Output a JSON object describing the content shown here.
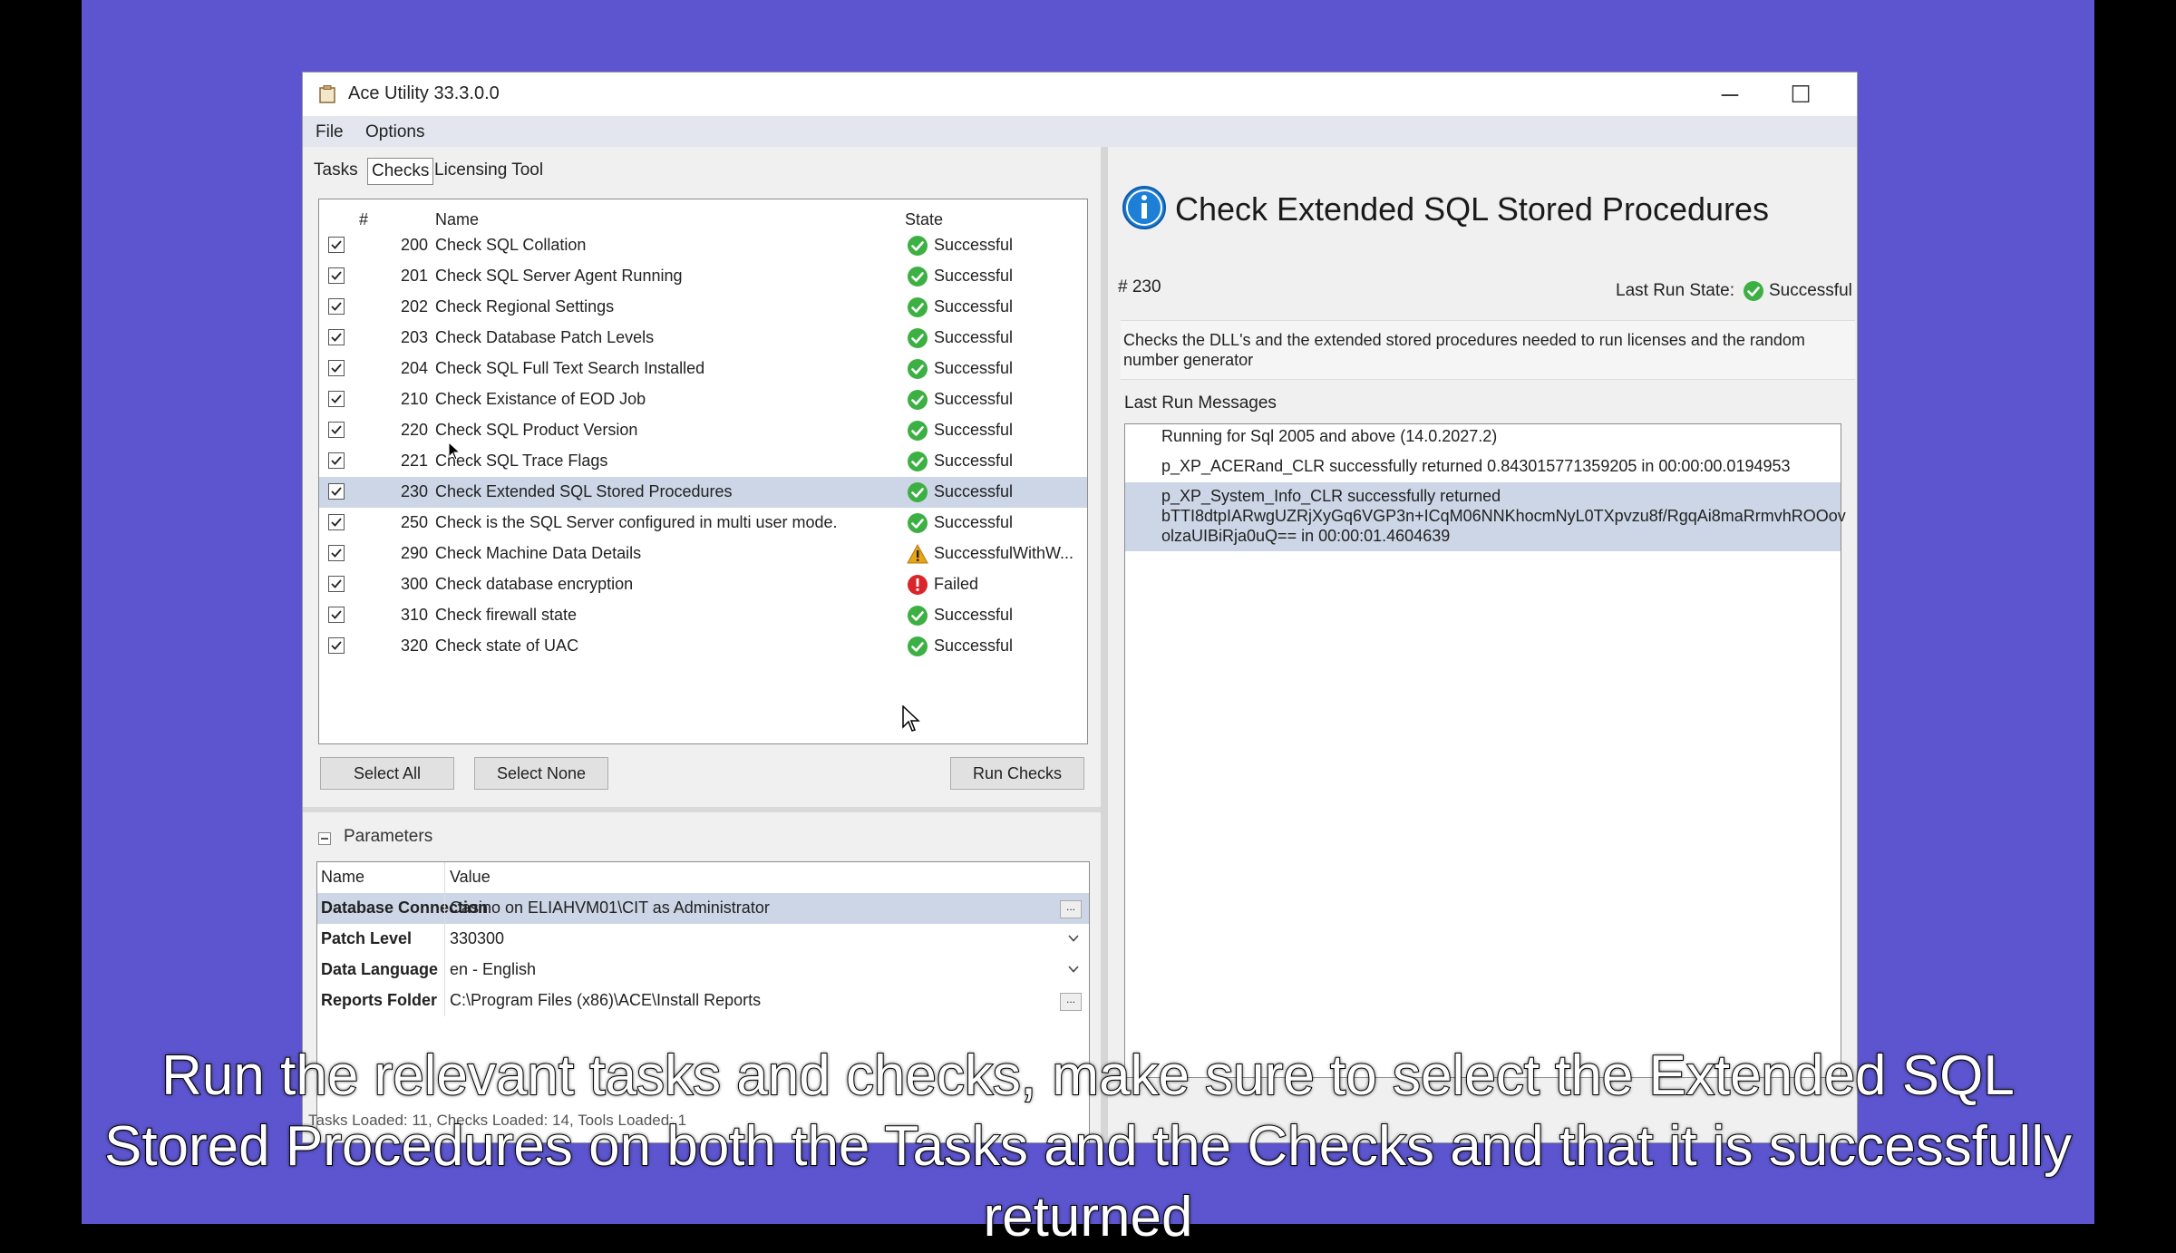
{
  "window": {
    "title": "Ace Utility 33.3.0.0",
    "controls": {
      "minimize": "─",
      "maximize": "☐",
      "close": "✕"
    }
  },
  "menu": {
    "file": "File",
    "options": "Options"
  },
  "tabs": [
    {
      "label": "Tasks",
      "active": false
    },
    {
      "label": "Checks",
      "active": true
    },
    {
      "label": "Licensing Tool",
      "active": false
    }
  ],
  "checks": {
    "columns": {
      "number": "#",
      "name": "Name",
      "state": "State"
    },
    "rows": [
      {
        "number": "200",
        "name": "Check SQL Collation",
        "state": "Successful",
        "status": "success",
        "selected": false
      },
      {
        "number": "201",
        "name": "Check SQL Server Agent Running",
        "state": "Successful",
        "status": "success",
        "selected": false
      },
      {
        "number": "202",
        "name": "Check Regional Settings",
        "state": "Successful",
        "status": "success",
        "selected": false
      },
      {
        "number": "203",
        "name": "Check Database Patch Levels",
        "state": "Successful",
        "status": "success",
        "selected": false
      },
      {
        "number": "204",
        "name": "Check SQL Full Text Search Installed",
        "state": "Successful",
        "status": "success",
        "selected": false
      },
      {
        "number": "210",
        "name": "Check Existance of EOD Job",
        "state": "Successful",
        "status": "success",
        "selected": false
      },
      {
        "number": "220",
        "name": "Check SQL Product Version",
        "state": "Successful",
        "status": "success",
        "selected": false
      },
      {
        "number": "221",
        "name": "Check SQL Trace Flags",
        "state": "Successful",
        "status": "success",
        "selected": false
      },
      {
        "number": "230",
        "name": "Check Extended SQL Stored Procedures",
        "state": "Successful",
        "status": "success",
        "selected": true
      },
      {
        "number": "250",
        "name": "Check is the SQL Server configured in multi user mode.",
        "state": "Successful",
        "status": "success",
        "selected": false
      },
      {
        "number": "290",
        "name": "Check Machine Data Details",
        "state": "SuccessfulWithW...",
        "status": "warning",
        "selected": false
      },
      {
        "number": "300",
        "name": "Check database encryption",
        "state": "Failed",
        "status": "failed",
        "selected": false
      },
      {
        "number": "310",
        "name": "Check firewall state",
        "state": "Successful",
        "status": "success",
        "selected": false
      },
      {
        "number": "320",
        "name": "Check state of UAC",
        "state": "Successful",
        "status": "success",
        "selected": false
      }
    ]
  },
  "buttons": {
    "select_all": "Select All",
    "select_none": "Select None",
    "run_checks": "Run Checks"
  },
  "parameters": {
    "heading": "Parameters",
    "columns": {
      "name": "Name",
      "value": "Value"
    },
    "rows": [
      {
        "name": "Database Connection",
        "value": "Casino on ELIAHVM01\\CIT as Administrator",
        "control": "ellipsis",
        "selected": true
      },
      {
        "name": "Patch Level",
        "value": "330300",
        "control": "dropdown",
        "selected": false
      },
      {
        "name": "Data Language",
        "value": "en - English",
        "control": "dropdown",
        "selected": false
      },
      {
        "name": "Reports Folder",
        "value": "C:\\Program Files (x86)\\ACE\\Install Reports",
        "control": "ellipsis",
        "selected": false
      }
    ],
    "ellipsis": "..."
  },
  "detail": {
    "title": "Check Extended SQL Stored Procedures",
    "id_label": "# 230",
    "last_run_state_label": "Last Run State:",
    "last_run_state": "Successful",
    "description": "Checks the DLL's and the extended stored procedures needed to run licenses and the random number generator",
    "messages_label": "Last Run Messages",
    "messages": [
      "Running for Sql 2005 and above (14.0.2027.2)",
      "p_XP_ACERand_CLR successfully returned 0.843015771359205 in 00:00:00.0194953"
    ],
    "selected_message": [
      "p_XP_System_Info_CLR successfully returned",
      "bTTI8dtpIARwgUZRjXyGq6VGP3n+ICqM06NNKhocmNyL0TXpvzu8f/RgqAi8maRrmvhROOov",
      "olzaUIBiRja0uQ== in 00:00:01.4604639"
    ]
  },
  "status_bar": "Tasks Loaded: 11, Checks Loaded: 14, Tools Loaded: 1",
  "caption": "Run the relevant tasks and checks, make sure to select the Extended SQL Stored Procedures on both the Tasks and the Checks and that it is successfully returned",
  "colors": {
    "success": "#3cb043",
    "warning": "#e8a317",
    "failed": "#d9262c",
    "info": "#1e7fd6",
    "selection": "#ccd6e6",
    "background": "#5d55cf"
  }
}
